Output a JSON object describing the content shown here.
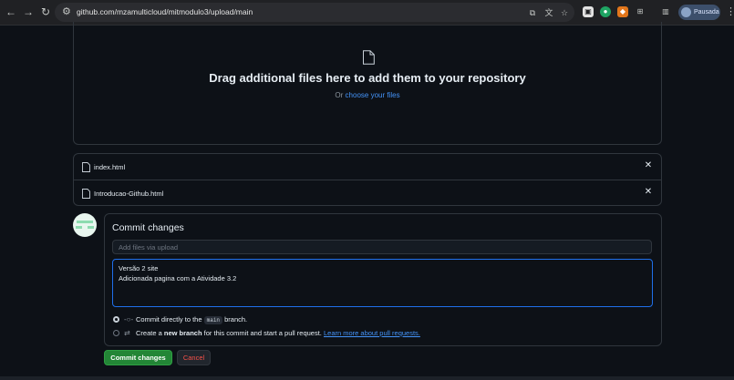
{
  "browser": {
    "url": "github.com/mzamulticloud/mitmodulo3/upload/main",
    "profile_label": "Pausada"
  },
  "dropzone": {
    "title": "Drag additional files here to add them to your repository",
    "or_text": "Or",
    "choose_link": "choose your files"
  },
  "files": [
    {
      "name": "index.html",
      "remove": "✕"
    },
    {
      "name": "Introducao-Github.html",
      "remove": "✕"
    }
  ],
  "commit": {
    "title": "Commit changes",
    "summary_placeholder": "Add files via upload",
    "description": "Versão 2 site\nAdicionada pagina com a Atividade 3.2",
    "option_direct": {
      "prefix": "Commit directly to the",
      "branch": "main",
      "suffix": "branch."
    },
    "option_new": {
      "prefix": "Create a",
      "bold": "new branch",
      "middle": "for this commit and start a pull request.",
      "link": "Learn more about pull requests."
    },
    "commit_button": "Commit changes",
    "cancel_button": "Cancel"
  },
  "colors": {
    "background": "#0d1117",
    "border": "#30363d",
    "link": "#4493f8",
    "commit_green": "#238636",
    "cancel_red": "#f85149",
    "focus_blue": "#1f6feb"
  },
  "icons": {
    "back": "arrow-left-icon",
    "forward": "arrow-right-icon",
    "reload": "reload-icon",
    "site_settings": "tune-icon",
    "file": "file-icon",
    "remove": "close-icon",
    "commit": "git-commit-icon",
    "pull_request": "git-pull-request-icon"
  }
}
